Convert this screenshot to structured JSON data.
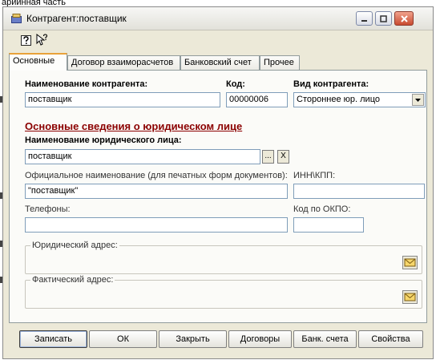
{
  "background": {
    "partial_text": "ариинная часть"
  },
  "window": {
    "title": "Контрагент:поставщик",
    "controls": {
      "minimize": "minimize-icon",
      "maximize": "maximize-icon",
      "close": "close-icon"
    }
  },
  "toolbar": {
    "help_icon": "help-icon",
    "context_help_icon": "context-help-icon"
  },
  "tabs": [
    "Основные",
    "Договор взаиморасчетов",
    "Банковский счет",
    "Прочее"
  ],
  "form": {
    "name_label": "Наименование контрагента:",
    "name_value": "поставщик",
    "code_label": "Код:",
    "code_value": "00000006",
    "type_label": "Вид контрагента:",
    "type_value": "Стороннее юр. лицо",
    "section_title": "Основные сведения о юридическом лице",
    "legal_name_label": "Наименование юридического лица:",
    "legal_name_value": "поставщик",
    "select_btn": "...",
    "clear_btn": "X",
    "official_label": "Официальное наименование (для печатных форм документов):",
    "official_value": "\"поставщик\"",
    "inn_label": "ИНН\\КПП:",
    "inn_value": "",
    "phones_label": "Телефоны:",
    "phones_value": "",
    "okpo_label": "Код по ОКПО:",
    "okpo_value": "",
    "legal_address_label": "Юридический адрес:",
    "actual_address_label": "Фактический адрес:"
  },
  "buttons": {
    "save": "Записать",
    "ok": "ОК",
    "close": "Закрыть",
    "contracts": "Договоры",
    "bank_accounts": "Банк. счета",
    "properties": "Свойства"
  },
  "colors": {
    "section_title": "#8b0000",
    "tab_accent": "#e8a23a"
  }
}
